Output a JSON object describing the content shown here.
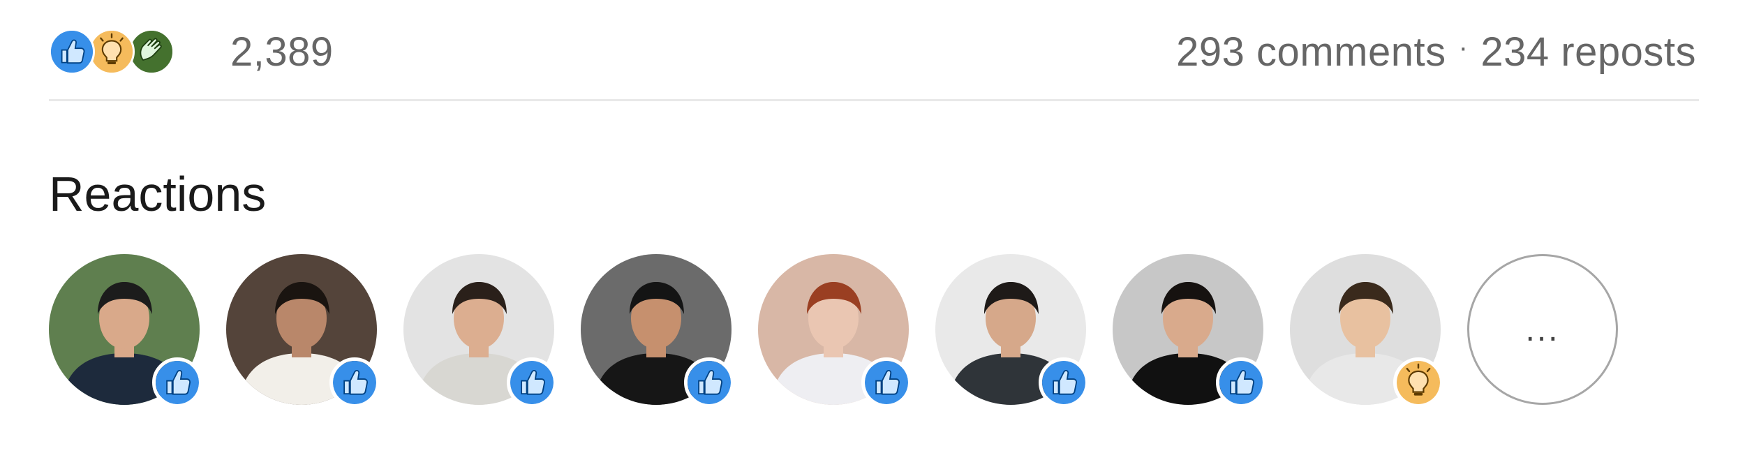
{
  "summary": {
    "reaction_icons": [
      "like-icon",
      "insightful-icon",
      "celebrate-icon"
    ],
    "total": "2,389",
    "comments": "293 comments",
    "separator": "·",
    "reposts": "234 reposts"
  },
  "reactions_section": {
    "title": "Reactions",
    "people": [
      {
        "reaction": "like-icon",
        "bg": "#5f7f4f",
        "skin": "#d9a98a",
        "hair": "#1c1c1c",
        "shirt": "#1d2a3c"
      },
      {
        "reaction": "like-icon",
        "bg": "#54443a",
        "skin": "#b9876a",
        "hair": "#1a1410",
        "shirt": "#f2efe9"
      },
      {
        "reaction": "like-icon",
        "bg": "#e3e3e3",
        "skin": "#dcae90",
        "hair": "#2a201a",
        "shirt": "#d8d7d2"
      },
      {
        "reaction": "like-icon",
        "bg": "#6b6b6b",
        "skin": "#c6906e",
        "hair": "#141414",
        "shirt": "#161616"
      },
      {
        "reaction": "like-icon",
        "bg": "#d8b7a6",
        "skin": "#eac6b2",
        "hair": "#9a3f22",
        "shirt": "#eeeef2"
      },
      {
        "reaction": "like-icon",
        "bg": "#e9e9e9",
        "skin": "#d6a88a",
        "hair": "#1e1a18",
        "shirt": "#2f3439"
      },
      {
        "reaction": "like-icon",
        "bg": "#c7c7c7",
        "skin": "#d9aa8c",
        "hair": "#161210",
        "shirt": "#111111"
      },
      {
        "reaction": "insightful-icon",
        "bg": "#dedede",
        "skin": "#e8c1a0",
        "hair": "#3a2a1c",
        "shirt": "#e8e8e8"
      }
    ],
    "more_label": "..."
  },
  "colors": {
    "like": "#378fe9",
    "insightful": "#f5bb5c",
    "celebrate": "#44712e",
    "muted_text": "#666666"
  }
}
